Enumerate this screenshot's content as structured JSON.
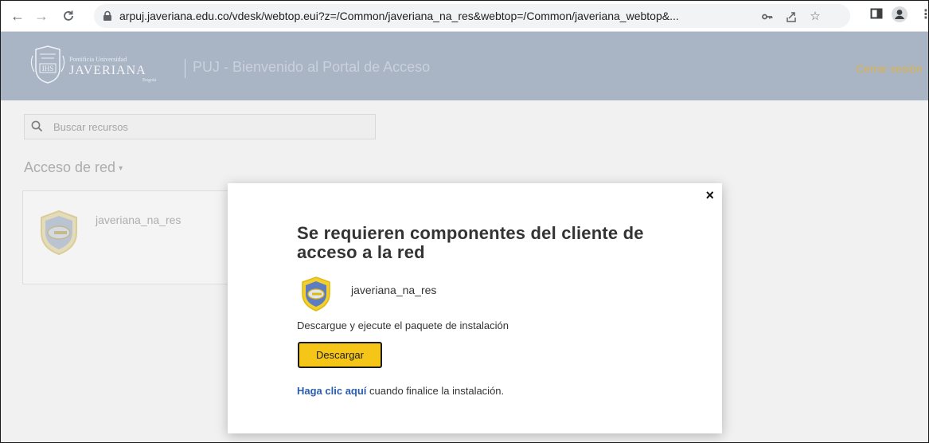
{
  "browser": {
    "url": "arpuj.javeriana.edu.co/vdesk/webtop.eui?z=/Common/javeriana_na_res&webtop=/Common/javeriana_webtop&..."
  },
  "header": {
    "logo_small": "Pontificia Universidad",
    "logo_name": "JAVERIANA",
    "logo_city": "Bogotá",
    "title": "PUJ - Bienvenido al Portal de Acceso",
    "logout": "Cerrar sesión"
  },
  "search": {
    "placeholder": "Buscar recursos"
  },
  "section": {
    "title": "Acceso de red",
    "caret": "▾"
  },
  "resource": {
    "label": "javeriana_na_res"
  },
  "modal": {
    "close": "×",
    "title": "Se requieren componentes del cliente de acceso a la red",
    "resource_name": "javeriana_na_res",
    "description": "Descargue y ejecute el paquete de instalación",
    "download_label": "Descargar",
    "footer_link": "Haga clic aquí",
    "footer_text": " cuando finalice la instalación."
  },
  "colors": {
    "header_bg": "#a9b4c4",
    "logout": "#d9b34a",
    "download_bg": "#f5c518",
    "link": "#2a5db0"
  },
  "icons": [
    "back-icon",
    "forward-icon",
    "reload-icon",
    "lock-icon",
    "key-icon",
    "share-icon",
    "star-icon",
    "sidepanel-icon",
    "profile-icon",
    "menu-icon",
    "search-icon",
    "shield-key-icon",
    "close-icon"
  ]
}
